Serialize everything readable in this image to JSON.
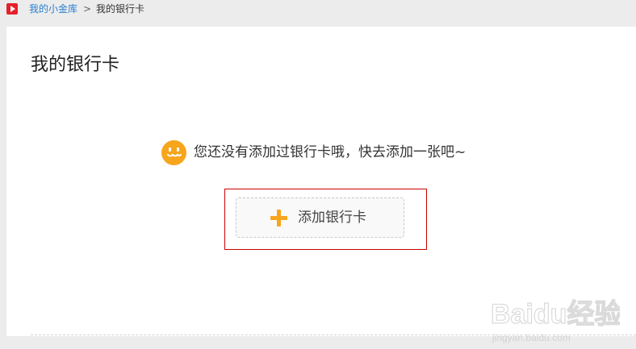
{
  "breadcrumb": {
    "home_link": "我的小金库",
    "separator": ">",
    "current": "我的银行卡"
  },
  "page": {
    "title": "我的银行卡"
  },
  "empty_state": {
    "message": "您还没有添加过银行卡哦，快去添加一张吧~",
    "icon": "smile-icon"
  },
  "actions": {
    "add_card_label": "添加银行卡",
    "add_card_icon": "plus-icon"
  },
  "watermark": {
    "brand": "Baidu经验",
    "url": "jingyan.baidu.com"
  },
  "colors": {
    "accent": "#f7a51c",
    "link": "#2a7fd0",
    "highlight": "#cc0000",
    "logo_red": "#e5212a"
  }
}
